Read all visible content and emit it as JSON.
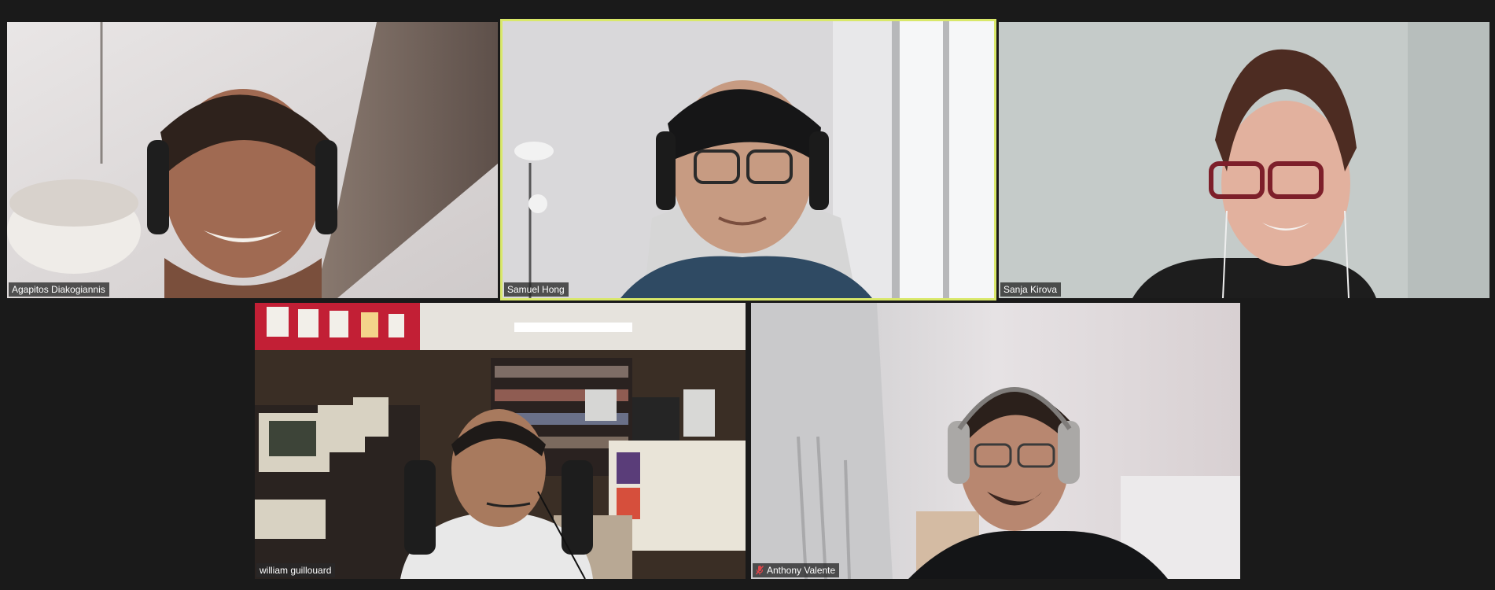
{
  "meeting": {
    "participants": [
      {
        "name": "Agapitos Diakogiannis",
        "active_speaker": false,
        "muted": false
      },
      {
        "name": "Samuel Hong",
        "active_speaker": true,
        "muted": false
      },
      {
        "name": "Sanja Kirova",
        "active_speaker": false,
        "muted": false
      },
      {
        "name": "william guillouard",
        "active_speaker": false,
        "muted": false
      },
      {
        "name": "Anthony Valente",
        "active_speaker": false,
        "muted": true
      }
    ]
  },
  "colors": {
    "background": "#1a1a1a",
    "active_speaker_border": "#d9e86a",
    "muted_icon": "#e0464b",
    "nameplate_bg": "#2b2b2b"
  },
  "icons": {
    "muted": "mic-muted-icon"
  }
}
